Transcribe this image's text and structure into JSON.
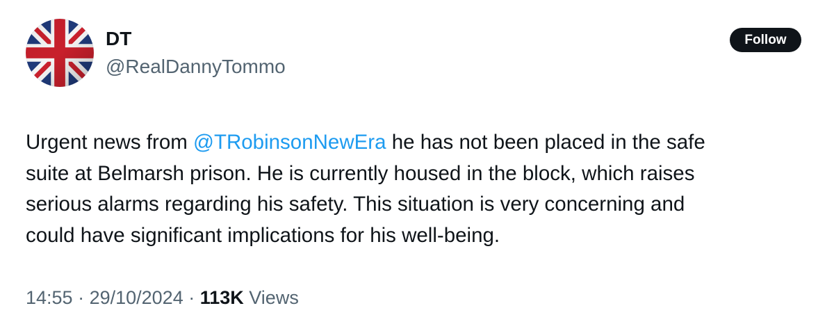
{
  "user": {
    "display_name": "DT",
    "handle": "@RealDannyTommo",
    "avatar_icon": "union-jack-flag-icon"
  },
  "follow_button": {
    "label": "Follow"
  },
  "tweet": {
    "line1_before": "Urgent news from ",
    "mention": "@TRobinsonNewEra",
    "line1_after": " he has not been placed in the safe",
    "line2": "suite at Belmarsh prison. He is currently housed in the block, which raises",
    "line3": "serious alarms regarding his safety. This situation is very concerning and",
    "line4": "could have significant implications for his well-being."
  },
  "meta": {
    "time": "14:55",
    "separator": " · ",
    "date": "29/10/2024",
    "views_count": "113K",
    "views_label": " Views"
  },
  "colors": {
    "text": "#0f1419",
    "secondary": "#536471",
    "link": "#1d9bf0",
    "button_bg": "#0f1419",
    "button_text": "#ffffff"
  }
}
